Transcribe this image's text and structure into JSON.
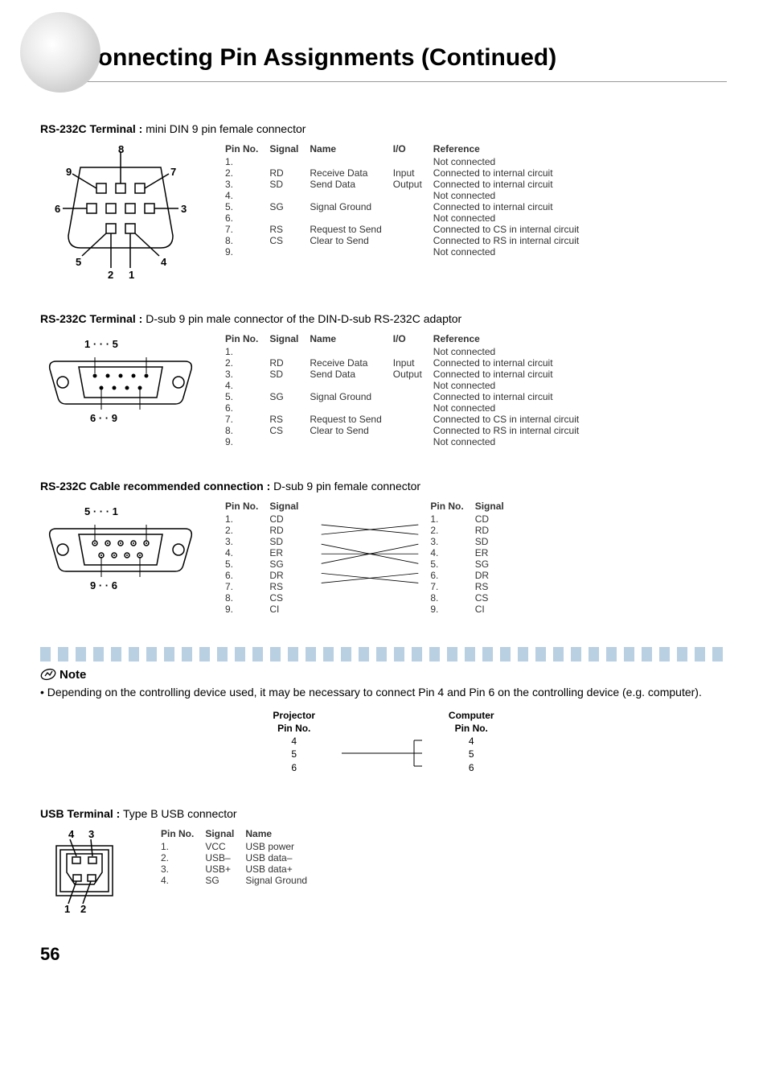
{
  "page": {
    "title": "Connecting Pin Assignments (Continued)",
    "number": "56"
  },
  "sections": {
    "rs232c_din": {
      "heading_bold": "RS-232C Terminal :",
      "heading_normal": " mini DIN 9 pin female connector",
      "headers": {
        "pin": "Pin No.",
        "signal": "Signal",
        "name": "Name",
        "io": "I/O",
        "ref": "Reference"
      },
      "rows": [
        {
          "pin": "1.",
          "signal": "",
          "name": "",
          "io": "",
          "ref": "Not connected"
        },
        {
          "pin": "2.",
          "signal": "RD",
          "name": "Receive Data",
          "io": "Input",
          "ref": "Connected to internal circuit"
        },
        {
          "pin": "3.",
          "signal": "SD",
          "name": "Send Data",
          "io": "Output",
          "ref": "Connected to internal circuit"
        },
        {
          "pin": "4.",
          "signal": "",
          "name": "",
          "io": "",
          "ref": "Not connected"
        },
        {
          "pin": "5.",
          "signal": "SG",
          "name": "Signal Ground",
          "io": "",
          "ref": "Connected to internal circuit"
        },
        {
          "pin": "6.",
          "signal": "",
          "name": "",
          "io": "",
          "ref": "Not connected"
        },
        {
          "pin": "7.",
          "signal": "RS",
          "name": "Request to Send",
          "io": "",
          "ref": "Connected to CS in internal circuit"
        },
        {
          "pin": "8.",
          "signal": "CS",
          "name": "Clear to Send",
          "io": "",
          "ref": "Connected to RS in internal circuit"
        },
        {
          "pin": "9.",
          "signal": "",
          "name": "",
          "io": "",
          "ref": "Not connected"
        }
      ],
      "diagram_labels": [
        "1",
        "2",
        "3",
        "4",
        "5",
        "6",
        "7",
        "8",
        "9"
      ]
    },
    "rs232c_dsub": {
      "heading_bold": "RS-232C Terminal :",
      "heading_normal": " D-sub 9 pin male connector of the DIN-D-sub RS-232C adaptor",
      "headers": {
        "pin": "Pin No.",
        "signal": "Signal",
        "name": "Name",
        "io": "I/O",
        "ref": "Reference"
      },
      "rows": [
        {
          "pin": "1.",
          "signal": "",
          "name": "",
          "io": "",
          "ref": "Not connected"
        },
        {
          "pin": "2.",
          "signal": "RD",
          "name": "Receive Data",
          "io": "Input",
          "ref": "Connected to internal circuit"
        },
        {
          "pin": "3.",
          "signal": "SD",
          "name": "Send Data",
          "io": "Output",
          "ref": "Connected to internal circuit"
        },
        {
          "pin": "4.",
          "signal": "",
          "name": "",
          "io": "",
          "ref": "Not connected"
        },
        {
          "pin": "5.",
          "signal": "SG",
          "name": "Signal Ground",
          "io": "",
          "ref": "Connected to internal circuit"
        },
        {
          "pin": "6.",
          "signal": "",
          "name": "",
          "io": "",
          "ref": "Not connected"
        },
        {
          "pin": "7.",
          "signal": "RS",
          "name": "Request to Send",
          "io": "",
          "ref": "Connected to CS in internal circuit"
        },
        {
          "pin": "8.",
          "signal": "CS",
          "name": "Clear to Send",
          "io": "",
          "ref": "Connected to RS in internal circuit"
        },
        {
          "pin": "9.",
          "signal": "",
          "name": "",
          "io": "",
          "ref": "Not connected"
        }
      ],
      "diagram_labels_top": "1   · · ·   5",
      "diagram_labels_bottom": "6   · ·   9"
    },
    "rs232c_cable": {
      "heading_bold": "RS-232C Cable recommended connection :",
      "heading_normal": " D-sub 9 pin female connector",
      "left_header": {
        "pin": "Pin No.",
        "signal": "Signal"
      },
      "right_header": {
        "pin": "Pin No.",
        "signal": "Signal"
      },
      "left_rows": [
        {
          "pin": "1.",
          "signal": "CD"
        },
        {
          "pin": "2.",
          "signal": "RD"
        },
        {
          "pin": "3.",
          "signal": "SD"
        },
        {
          "pin": "4.",
          "signal": "ER"
        },
        {
          "pin": "5.",
          "signal": "SG"
        },
        {
          "pin": "6.",
          "signal": "DR"
        },
        {
          "pin": "7.",
          "signal": "RS"
        },
        {
          "pin": "8.",
          "signal": "CS"
        },
        {
          "pin": "9.",
          "signal": "CI"
        }
      ],
      "right_rows": [
        {
          "pin": "1.",
          "signal": "CD"
        },
        {
          "pin": "2.",
          "signal": "RD"
        },
        {
          "pin": "3.",
          "signal": "SD"
        },
        {
          "pin": "4.",
          "signal": "ER"
        },
        {
          "pin": "5.",
          "signal": "SG"
        },
        {
          "pin": "6.",
          "signal": "DR"
        },
        {
          "pin": "7.",
          "signal": "RS"
        },
        {
          "pin": "8.",
          "signal": "CS"
        },
        {
          "pin": "9.",
          "signal": "CI"
        }
      ],
      "diagram_labels_top": "5   · · ·   1",
      "diagram_labels_bottom": "9   · ·   6"
    },
    "note": {
      "label": "Note",
      "text": "• Depending on the controlling device used, it may be necessary to connect Pin 4 and Pin 6 on the controlling device (e.g. computer).",
      "mini_headers": {
        "left_top": "Projector",
        "left_bottom": "Pin No.",
        "right_top": "Computer",
        "right_bottom": "Pin No."
      },
      "mini_rows_left": [
        "4",
        "5",
        "6"
      ],
      "mini_rows_right": [
        "4",
        "5",
        "6"
      ]
    },
    "usb": {
      "heading_bold": "USB Terminal :",
      "heading_normal": " Type B USB connector",
      "headers": {
        "pin": "Pin No.",
        "signal": "Signal",
        "name": "Name"
      },
      "rows": [
        {
          "pin": "1.",
          "signal": "VCC",
          "name": "USB power"
        },
        {
          "pin": "2.",
          "signal": "USB–",
          "name": "USB data–"
        },
        {
          "pin": "3.",
          "signal": "USB+",
          "name": "USB data+"
        },
        {
          "pin": "4.",
          "signal": "SG",
          "name": "Signal Ground"
        }
      ],
      "diagram_labels": [
        "1",
        "2",
        "3",
        "4"
      ]
    }
  }
}
